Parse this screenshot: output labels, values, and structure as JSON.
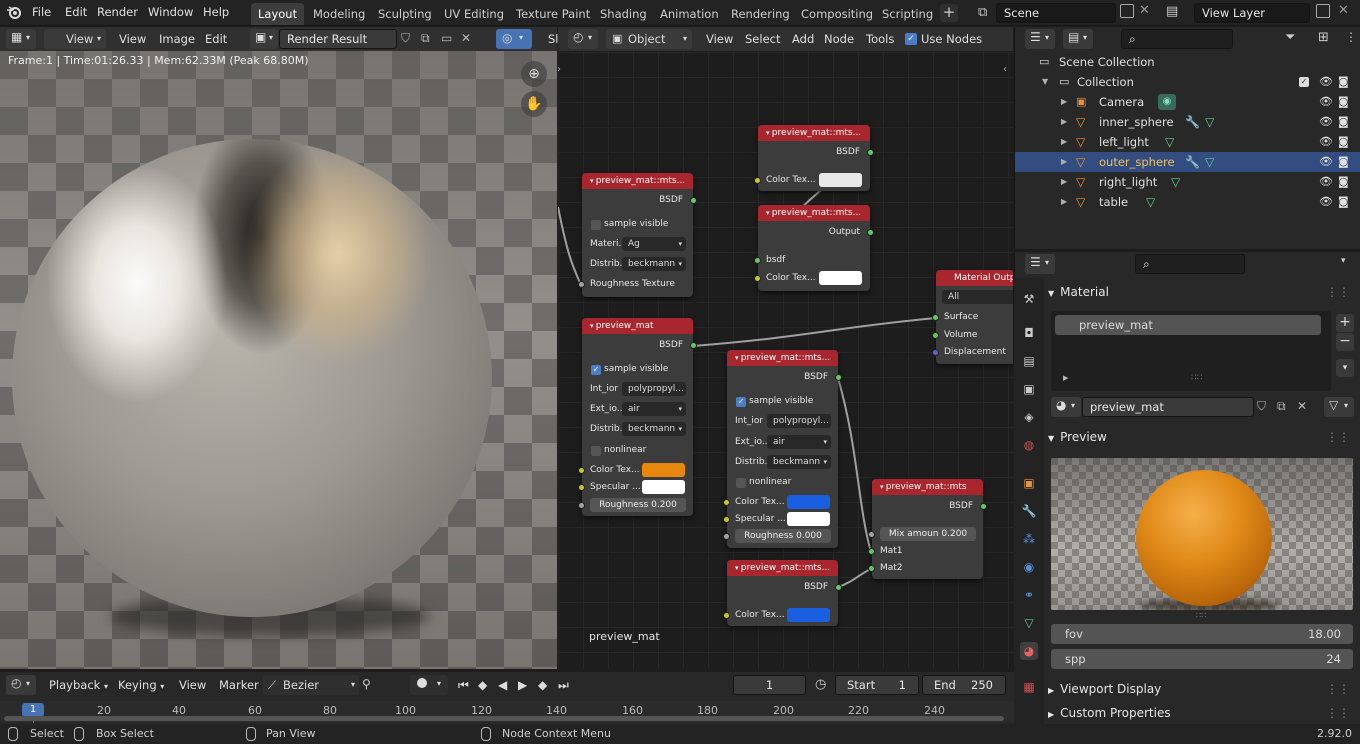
{
  "topbar": {
    "menus": [
      "File",
      "Edit",
      "Render",
      "Window",
      "Help"
    ],
    "workspaces": [
      "Layout",
      "Modeling",
      "Sculpting",
      "UV Editing",
      "Texture Paint",
      "Shading",
      "Animation",
      "Rendering",
      "Compositing",
      "Scripting"
    ],
    "active_workspace": "Layout",
    "scene": "Scene",
    "view_layer": "View Layer"
  },
  "image_editor": {
    "view_mode": "View",
    "menus": [
      "View",
      "Image",
      "Edit"
    ],
    "image_name": "Render Result",
    "slot_label": "Sl",
    "render_info": "Frame:1 | Time:01:26.33 | Mem:62.33M (Peak 68.80M)"
  },
  "node_editor": {
    "object_type": "Object",
    "menus": [
      "View",
      "Select",
      "Add",
      "Node",
      "Tools"
    ],
    "use_nodes_label": "Use Nodes",
    "material_label": "preview_mat",
    "nodes": {
      "n1": {
        "title": "preview_mat::mts...",
        "output": "BSDF",
        "sample_visible": "sample visible",
        "material_label": "Materi...",
        "material_value": "Ag",
        "distrib_label": "Distrib...",
        "distrib_value": "beckmann",
        "roughness_texture": "Roughness Texture"
      },
      "n2": {
        "title": "preview_mat::mts...",
        "output": "BSDF",
        "color_tex": "Color Tex..."
      },
      "n3": {
        "title": "preview_mat::mts...",
        "output": "Output",
        "bsdf": "bsdf",
        "color_tex": "Color Tex..."
      },
      "n4": {
        "title": "preview_mat",
        "output": "BSDF",
        "sample_visible": "sample visible",
        "int_ior_label": "Int_ior",
        "int_ior_value": "polypropyl...",
        "ext_ior_label": "Ext_io...",
        "ext_ior_value": "air",
        "distrib_label": "Distrib...",
        "distrib_value": "beckmann",
        "nonlinear": "nonlinear",
        "color_tex": "Color Tex...",
        "specular": "Specular ...",
        "roughness_label": "Roughness",
        "roughness_value": "0.200"
      },
      "n5": {
        "title": "preview_mat::mts...",
        "output": "BSDF",
        "sample_visible": "sample visible",
        "int_ior_label": "Int_ior",
        "int_ior_value": "polypropyl...",
        "ext_ior_label": "Ext_io...",
        "ext_ior_value": "air",
        "distrib_label": "Distrib...",
        "distrib_value": "beckmann",
        "nonlinear": "nonlinear",
        "color_tex": "Color Tex...",
        "specular": "Specular ...",
        "roughness_label": "Roughness",
        "roughness_value": "0.000"
      },
      "n6": {
        "title": "preview_mat::mts",
        "output": "BSDF",
        "mix_label": "Mix amoun",
        "mix_value": "0.200",
        "mat1": "Mat1",
        "mat2": "Mat2"
      },
      "n7": {
        "title": "preview_mat::mts...",
        "output": "BSDF",
        "color_tex": "Color Tex..."
      },
      "out": {
        "title": "Material Output",
        "target": "All",
        "surface": "Surface",
        "volume": "Volume",
        "displacement": "Displacement"
      }
    },
    "colors": {
      "node_header": "#a8262e",
      "orange": "#e8870e",
      "blue": "#1a5fe0",
      "white": "#ffffff",
      "light_grey": "#e8e8e8"
    }
  },
  "outliner": {
    "root": "Scene Collection",
    "collection": "Collection",
    "items": [
      {
        "name": "Camera",
        "icon": "camera-icon"
      },
      {
        "name": "inner_sphere",
        "icon": "mesh-icon"
      },
      {
        "name": "left_light",
        "icon": "mesh-icon"
      },
      {
        "name": "outer_sphere",
        "icon": "mesh-icon"
      },
      {
        "name": "right_light",
        "icon": "mesh-icon"
      },
      {
        "name": "table",
        "icon": "mesh-icon"
      }
    ],
    "selected": "outer_sphere"
  },
  "properties": {
    "material_panel": "Material",
    "material_slot": "preview_mat",
    "material_name": "preview_mat",
    "preview_panel": "Preview",
    "fov_label": "fov",
    "fov_value": "18.00",
    "spp_label": "spp",
    "spp_value": "24",
    "viewport_display": "Viewport Display",
    "custom_properties": "Custom Properties"
  },
  "timeline": {
    "menus": [
      "Playback",
      "Keying",
      "View",
      "Marker"
    ],
    "interpolation": "Bezier",
    "current_frame": "1",
    "start_label": "Start",
    "start_value": "1",
    "end_label": "End",
    "end_value": "250",
    "ruler": [
      "1",
      "20",
      "40",
      "60",
      "80",
      "100",
      "120",
      "140",
      "160",
      "180",
      "200",
      "220",
      "240"
    ]
  },
  "statusbar": {
    "select": "Select",
    "box_select": "Box Select",
    "pan_view": "Pan View",
    "context_menu": "Node Context Menu",
    "version": "2.92.0"
  }
}
